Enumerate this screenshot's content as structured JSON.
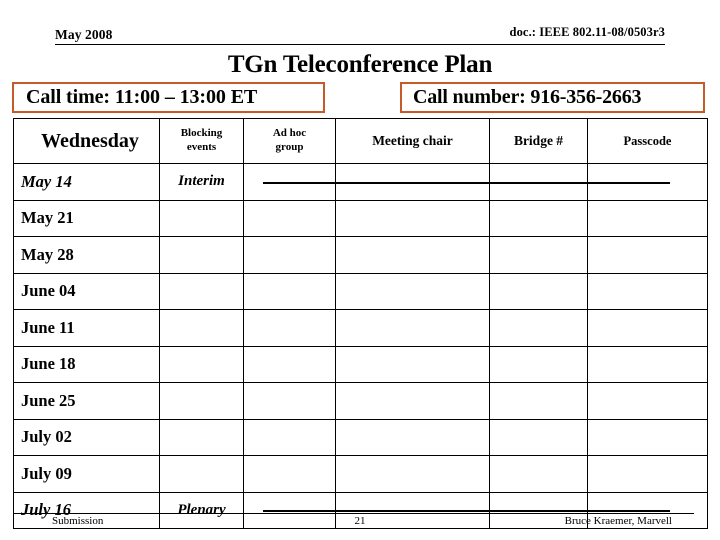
{
  "header": {
    "left": "May 2008",
    "right": "doc.: IEEE 802.11-08/0503r3"
  },
  "title": "TGn Teleconference Plan",
  "call_info": {
    "time": "Call time: 11:00 – 13:00 ET",
    "number": "Call number: 916-356-2663",
    "box_border_color": "#c45b28"
  },
  "table": {
    "columns": [
      "Wednesday",
      "Blocking events",
      "Ad hoc group",
      "Meeting chair",
      "Bridge #",
      "Passcode"
    ],
    "columns_split": {
      "blocking_line1": "Blocking",
      "blocking_line2": "events",
      "adhoc_line1": "Ad hoc",
      "adhoc_line2": "group"
    },
    "rows": [
      {
        "day": "May  14",
        "blocking": "Interim",
        "adhoc": "",
        "chair": "",
        "bridge": "",
        "passcode": "",
        "special": true
      },
      {
        "day": "May  21",
        "blocking": "",
        "adhoc": "",
        "chair": "",
        "bridge": "",
        "passcode": "",
        "special": false
      },
      {
        "day": "May  28",
        "blocking": "",
        "adhoc": "",
        "chair": "",
        "bridge": "",
        "passcode": "",
        "special": false
      },
      {
        "day": "June  04",
        "blocking": "",
        "adhoc": "",
        "chair": "",
        "bridge": "",
        "passcode": "",
        "special": false
      },
      {
        "day": "June  11",
        "blocking": "",
        "adhoc": "",
        "chair": "",
        "bridge": "",
        "passcode": "",
        "special": false
      },
      {
        "day": "June  18",
        "blocking": "",
        "adhoc": "",
        "chair": "",
        "bridge": "",
        "passcode": "",
        "special": false
      },
      {
        "day": "June  25",
        "blocking": "",
        "adhoc": "",
        "chair": "",
        "bridge": "",
        "passcode": "",
        "special": false
      },
      {
        "day": "July  02",
        "blocking": "",
        "adhoc": "",
        "chair": "",
        "bridge": "",
        "passcode": "",
        "special": false
      },
      {
        "day": "July  09",
        "blocking": "",
        "adhoc": "",
        "chair": "",
        "bridge": "",
        "passcode": "",
        "special": false
      },
      {
        "day": "July  16",
        "blocking": "Plenary",
        "adhoc": "",
        "chair": "",
        "bridge": "",
        "passcode": "",
        "special": true
      }
    ]
  },
  "footer": {
    "left": "Submission",
    "page": "21",
    "right": "Bruce Kraemer, Marvell"
  }
}
